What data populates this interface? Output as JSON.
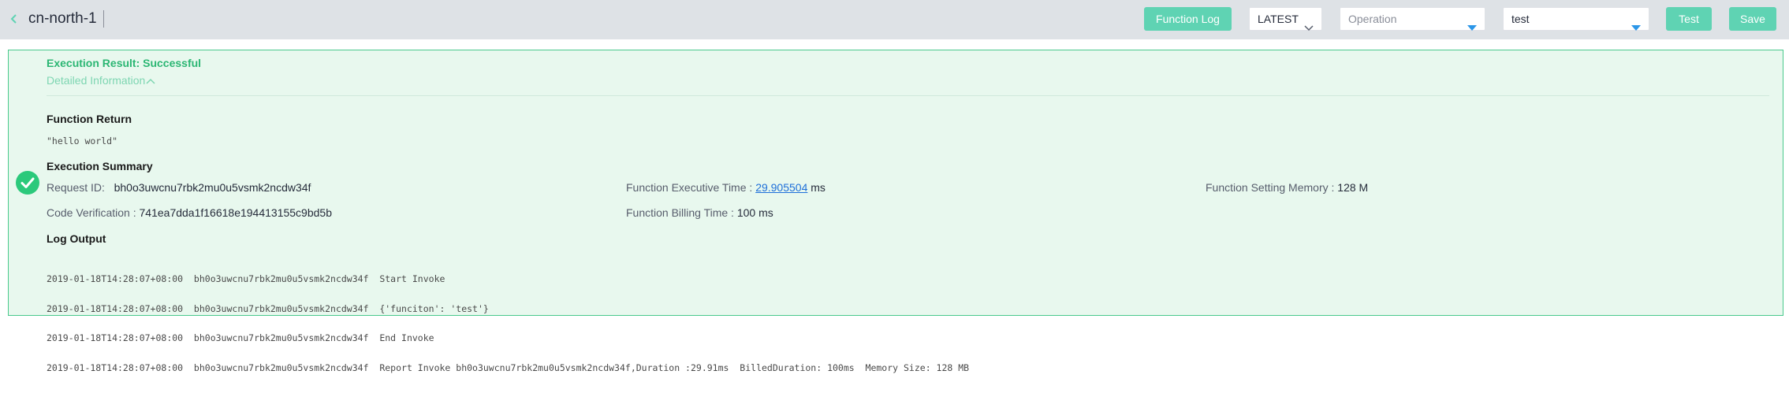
{
  "header": {
    "region": "cn-north-1",
    "function_log_label": "Function Log",
    "version": "LATEST",
    "operation_placeholder": "Operation",
    "event": "test",
    "test_label": "Test",
    "save_label": "Save",
    "accent_color": "#5fd3b3"
  },
  "result": {
    "status": "Execution Result: Successful",
    "detail_toggle": "Detailed Information",
    "status_color": "#2bb673",
    "function_return": {
      "heading": "Function Return",
      "value": "\"hello world\""
    },
    "summary": {
      "heading": "Execution Summary",
      "request_id_label": "Request ID:",
      "request_id": "bh0o3uwcnu7rbk2mu0u5vsmk2ncdw34f",
      "exec_time_label": "Function Executive Time :",
      "exec_time_value": "29.905504",
      "exec_time_unit": "ms",
      "memory_label": "Function Setting Memory :",
      "memory_value": "128 M",
      "code_verif_label": "Code Verification :",
      "code_verif_value": "741ea7dda1f16618e194413155c9bd5b",
      "billing_label": "Function Billing Time :",
      "billing_value": "100 ms"
    },
    "log": {
      "heading": "Log Output",
      "lines": [
        "2019-01-18T14:28:07+08:00  bh0o3uwcnu7rbk2mu0u5vsmk2ncdw34f  Start Invoke",
        "2019-01-18T14:28:07+08:00  bh0o3uwcnu7rbk2mu0u5vsmk2ncdw34f  {'funciton': 'test'}",
        "2019-01-18T14:28:07+08:00  bh0o3uwcnu7rbk2mu0u5vsmk2ncdw34f  End Invoke",
        "2019-01-18T14:28:07+08:00  bh0o3uwcnu7rbk2mu0u5vsmk2ncdw34f  Report Invoke bh0o3uwcnu7rbk2mu0u5vsmk2ncdw34f,Duration :29.91ms  BilledDuration: 100ms  Memory Size: 128 MB"
      ]
    }
  }
}
